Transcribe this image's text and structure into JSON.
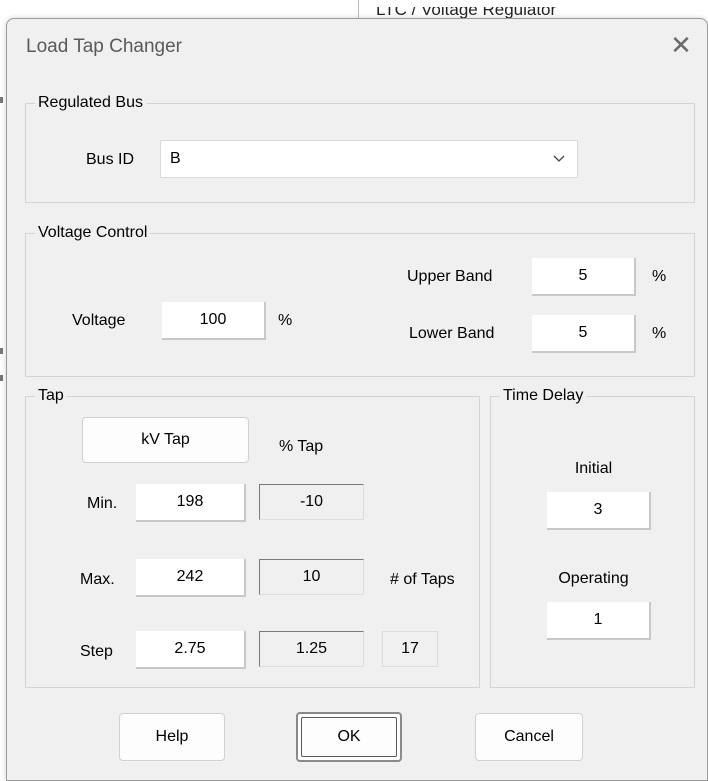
{
  "background": {
    "window_title": "LTC / Voltage Regulator"
  },
  "dialog": {
    "title": "Load Tap Changer",
    "close_glyph": "✕"
  },
  "regulated_bus": {
    "legend": "Regulated Bus",
    "bus_id_label": "Bus ID",
    "bus_id_value": "B"
  },
  "voltage_control": {
    "legend": "Voltage Control",
    "voltage_label": "Voltage",
    "voltage_value": "100",
    "voltage_unit": "%",
    "upper_band_label": "Upper Band",
    "upper_band_value": "5",
    "upper_band_unit": "%",
    "lower_band_label": "Lower Band",
    "lower_band_value": "5",
    "lower_band_unit": "%"
  },
  "tap": {
    "legend": "Tap",
    "kv_tap_button": "kV Tap",
    "percent_tap_header": "% Tap",
    "min_label": "Min.",
    "min_kv": "198",
    "min_percent": "-10",
    "max_label": "Max.",
    "max_kv": "242",
    "max_percent": "10",
    "num_taps_label": "# of Taps",
    "step_label": "Step",
    "step_kv": "2.75",
    "step_percent": "1.25",
    "num_taps_value": "17"
  },
  "time_delay": {
    "legend": "Time Delay",
    "initial_label": "Initial",
    "initial_value": "3",
    "operating_label": "Operating",
    "operating_value": "1"
  },
  "buttons": {
    "help": "Help",
    "ok": "OK",
    "cancel": "Cancel"
  }
}
